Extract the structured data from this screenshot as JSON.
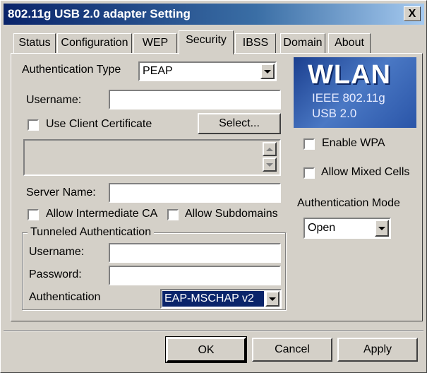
{
  "window": {
    "title": "802.11g USB 2.0 adapter Setting",
    "close_label": "X"
  },
  "tabs": [
    {
      "label": "Status"
    },
    {
      "label": "Configuration"
    },
    {
      "label": "WEP"
    },
    {
      "label": "Security"
    },
    {
      "label": "IBSS"
    },
    {
      "label": "Domain"
    },
    {
      "label": "About"
    }
  ],
  "active_tab": "Security",
  "security": {
    "auth_type_label": "Authentication Type",
    "auth_type_value": "PEAP",
    "username_label": "Username:",
    "username_value": "",
    "use_client_cert_label": "Use Client Certificate",
    "use_client_cert_checked": false,
    "select_button": "Select...",
    "server_name_label": "Server Name:",
    "server_name_value": "",
    "allow_intermediate_ca_label": "Allow Intermediate CA",
    "allow_subdomains_label": "Allow Subdomains",
    "tunneled": {
      "group_label": "Tunneled Authentication",
      "username_label": "Username:",
      "password_label": "Password:",
      "auth_label": "Authentication",
      "auth_value": "EAP-MSCHAP v2"
    }
  },
  "logo": {
    "title": "WLAN",
    "line1": "IEEE 802.11g",
    "line2": "USB 2.0"
  },
  "right": {
    "enable_wpa_label": "Enable WPA",
    "allow_mixed_cells_label": "Allow Mixed Cells",
    "auth_mode_label": "Authentication Mode",
    "auth_mode_value": "Open"
  },
  "buttons": {
    "ok": "OK",
    "cancel": "Cancel",
    "apply": "Apply"
  }
}
